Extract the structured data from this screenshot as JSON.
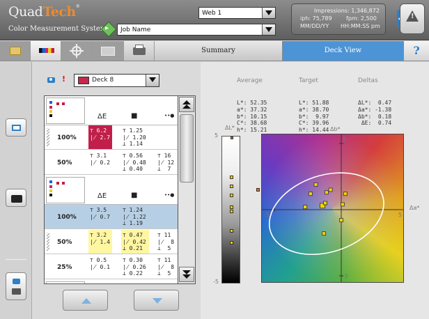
{
  "header": {
    "logo_quad": "Quad",
    "logo_tech": "Tech",
    "logo_mark": "®",
    "tagline": "Color Measurement System",
    "web_select": "Web 1",
    "job_name": "Job Name",
    "impressions": "Impressions: 1,346,872",
    "iph": "iph: 75,789",
    "fpm": "fpm: 2,500",
    "date": "MM/DD/YY",
    "time": "HH:MM:SS pm"
  },
  "toolbar": {
    "tabs": [
      {
        "label": "Summary"
      },
      {
        "label": "Deck View"
      }
    ],
    "help_label": "?",
    "active_tab_color": "#4c94d6",
    "icons": [
      "table-icon",
      "color-bars-icon",
      "crosshair-icon",
      "trend-chart-icon",
      "printer-icon"
    ]
  },
  "deck": {
    "alert_mark": "!",
    "selected": "Deck 8",
    "swatch_color": "#c6284a"
  },
  "grid": {
    "headers": [
      "ΔE",
      "■",
      "••●"
    ],
    "rows": [
      {
        "pct": "100%",
        "de": "⊤ 6.2\n∤ 2.7",
        "solid": "⊤ 1.25\n∤ 1.20\n⊥ 1.14",
        "dot": ""
      },
      {
        "pct": "50%",
        "de": "⊤ 3.1\n∤ 0.2",
        "solid": "⊤ 0.56\n∤ 0.48\n⊥ 0.40",
        "dot": "⊤ 16\n∤ 12\n⊥  7"
      },
      {
        "pct": "100%",
        "de": "⊤ 3.5\n∤ 0.7",
        "solid": "⊤ 1.24\n∤ 1.22\n⊥ 1.19",
        "dot": ""
      },
      {
        "pct": "50%",
        "de": "⊤ 3.2\n∤ 1.4",
        "solid": "⊤ 0.47\n∤ 0.42\n⊥ 0.21",
        "dot": "⊤ 11\n∤  8\n⊥  5"
      },
      {
        "pct": "25%",
        "de": "⊤ 0.5\n∤ 0.1",
        "solid": "⊤ 0.30\n∤ 0.26\n⊥ 0.22",
        "dot": "⊤ 11\n∤  8\n⊥  5"
      }
    ]
  },
  "stats": {
    "average": {
      "title": "Average",
      "lines": "L*: 52.35\na*: 37.32\nb*: 10.15\nC*: 38.68\nh*: 15.21"
    },
    "target": {
      "title": "Target",
      "lines": "L*: 51.88\na*: 38.70\nb*:  9.97\nC*: 39.96\nh*: 14.44"
    },
    "deltas": {
      "title": "Deltas",
      "lines": "ΔL*:  0.47\nΔa*: -1.38\nΔb*:  0.18\n ΔE:  0.74"
    }
  },
  "chart_data": [
    {
      "type": "scatter",
      "title": "",
      "ylabel": "ΔL*",
      "ylim": [
        -5,
        5
      ],
      "tick_labels": [
        "5",
        "-5"
      ],
      "points_y": [
        4.9,
        2.2,
        1.6,
        1.0,
        0.2,
        -0.1,
        -1.4,
        -2.2
      ],
      "out_of_range_marker": "top"
    },
    {
      "type": "scatter",
      "title": "",
      "xlabel": "Δa*",
      "ylabel": "Δb*",
      "xlim": [
        -5,
        5
      ],
      "ylim": [
        -5,
        5
      ],
      "tick_labels": {
        "x_neg": "-5",
        "x_pos": "5",
        "y_pos": "5",
        "y_neg": "-5"
      },
      "points": [
        {
          "x": -1.9,
          "y": 1.9
        },
        {
          "x": -1.1,
          "y": 1.3
        },
        {
          "x": -0.8,
          "y": 1.5
        },
        {
          "x": -2.3,
          "y": 1.2
        },
        {
          "x": -2.7,
          "y": 0.2
        },
        {
          "x": -1.4,
          "y": 0.3
        },
        {
          "x": -1.2,
          "y": 0.5
        },
        {
          "x": 0.1,
          "y": 0.4
        },
        {
          "x": 0.3,
          "y": 1.2
        },
        {
          "x": 0.0,
          "y": -0.8
        },
        {
          "x": -1.3,
          "y": -1.8
        }
      ],
      "out_of_range_points": [
        {
          "side": "left",
          "y": 1.4
        }
      ],
      "ellipse": {
        "cx": -1.1,
        "cy": -0.3,
        "rx": 4.4,
        "ry": 2.9,
        "rotation_deg": -18
      }
    }
  ]
}
